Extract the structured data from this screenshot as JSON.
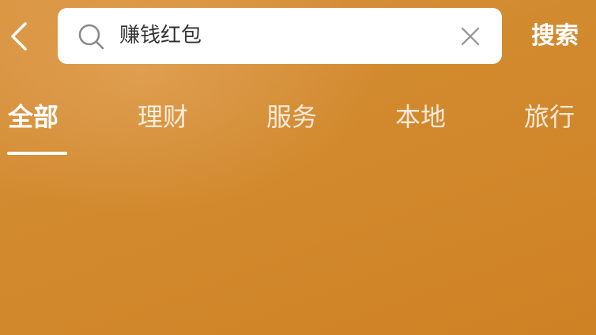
{
  "header": {
    "back_icon": "chevron-left-icon",
    "search": {
      "icon": "search-icon",
      "value": "赚钱红包",
      "clear_icon": "close-icon"
    },
    "search_button_label": "搜索"
  },
  "tabs": [
    {
      "label": "全部",
      "active": true
    },
    {
      "label": "理财",
      "active": false
    },
    {
      "label": "服务",
      "active": false
    },
    {
      "label": "本地",
      "active": false
    },
    {
      "label": "旅行",
      "active": false
    }
  ],
  "colors": {
    "background": "#d28a2f",
    "text": "#ffffff",
    "search_box": "#ffffff",
    "search_text": "#333333"
  }
}
